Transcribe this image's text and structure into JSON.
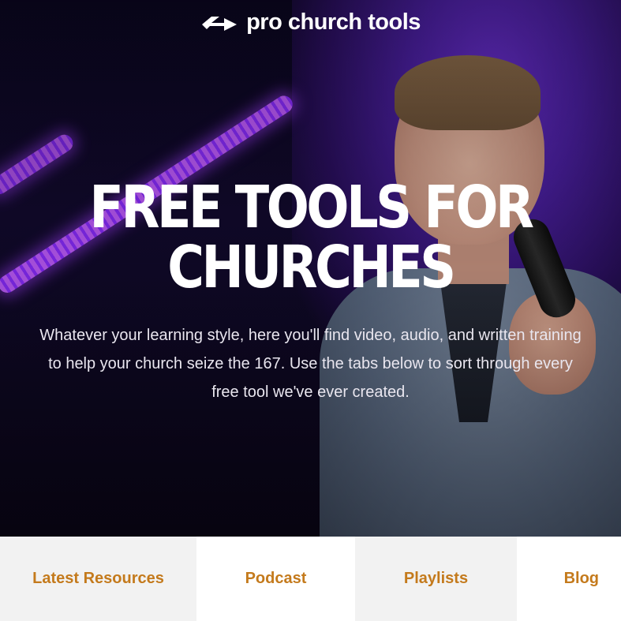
{
  "brand": {
    "name": "pro church tools",
    "logo_icon": "arrow-mark-icon"
  },
  "hero": {
    "headline_line1": "FREE TOOLS FOR",
    "headline_line2": "CHURCHES",
    "description_line1": "Whatever your learning style, here you'll find video, audio, and written training",
    "description_line2": "to help your church seize the 167. Use the tabs below to sort through every",
    "description_line3": "free tool we've ever created."
  },
  "tabs": [
    {
      "label": "Latest Resources"
    },
    {
      "label": "Podcast"
    },
    {
      "label": "Playlists"
    },
    {
      "label": "Blog"
    }
  ],
  "colors": {
    "tab_text": "#c47a1c",
    "hero_purple": "#6a2fd0",
    "tab_bg": "#f2f2f2"
  }
}
